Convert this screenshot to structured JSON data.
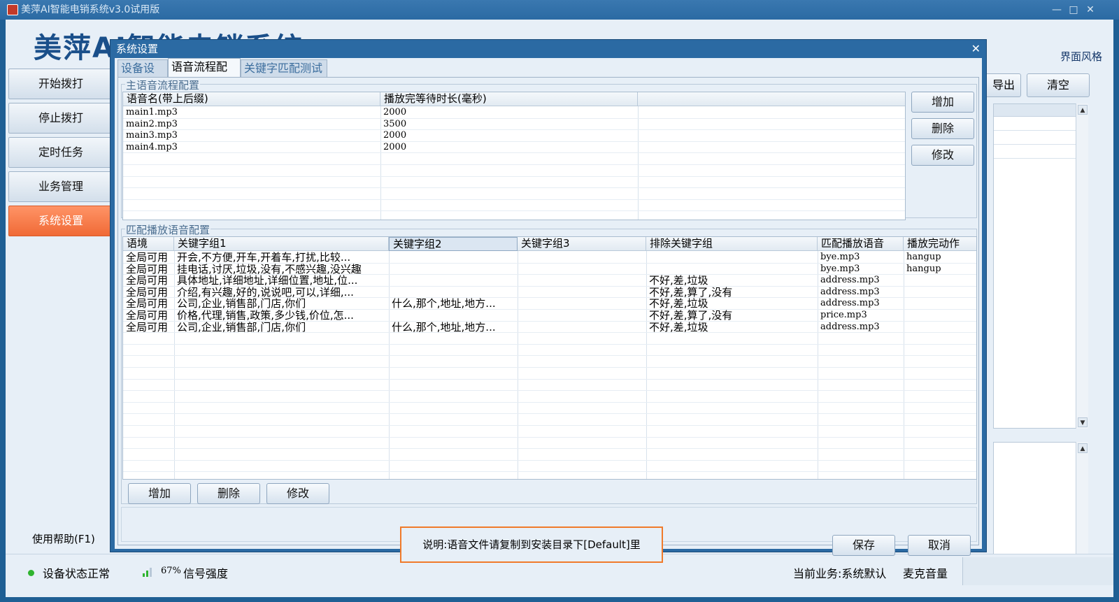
{
  "window": {
    "title": "美萍AI智能电销系统v3.0试用版",
    "brand": "美萍AI智能电销系统",
    "skin_label": "界面风格",
    "min_glyph": "—",
    "max_glyph": "□",
    "close_glyph": "✕"
  },
  "sidebar": {
    "items": [
      {
        "label": "开始拨打"
      },
      {
        "label": "停止拨打"
      },
      {
        "label": "定时任务"
      },
      {
        "label": "业务管理"
      },
      {
        "label": "系统设置"
      }
    ],
    "help": "使用帮助(F1)"
  },
  "background": {
    "export_label": "导出",
    "clear_label": "清空"
  },
  "statusbar": {
    "device_status": "设备状态正常",
    "signal_percent": "67%",
    "signal_label": "信号强度",
    "current_business": "当前业务:系统默认",
    "mic_volume": "麦克音量"
  },
  "dialog": {
    "title": "系统设置",
    "close_glyph": "✕",
    "tabs": [
      "设备设置",
      "语音流程配置",
      "关键字匹配测试"
    ],
    "main_group_title": "主语音流程配置",
    "main_columns": [
      "语音名(带上后缀)",
      "播放完等待时长(毫秒)",
      ""
    ],
    "main_rows": [
      [
        "main1.mp3",
        "2000"
      ],
      [
        "main2.mp3",
        "3500"
      ],
      [
        "main3.mp3",
        "2000"
      ],
      [
        "main4.mp3",
        "2000"
      ]
    ],
    "main_buttons": {
      "add": "增加",
      "delete": "删除",
      "edit": "修改"
    },
    "match_group_title": "匹配播放语音配置",
    "match_columns": [
      "语境",
      "关键字组1",
      "关键字组2",
      "关键字组3",
      "排除关键字组",
      "匹配播放语音",
      "播放完动作"
    ],
    "match_rows": [
      [
        "全局可用",
        "开会,不方便,开车,开着车,打扰,比较...",
        "",
        "",
        "",
        "bye.mp3",
        "hangup"
      ],
      [
        "全局可用",
        "挂电话,讨厌,垃圾,没有,不感兴趣,没兴趣",
        "",
        "",
        "",
        "bye.mp3",
        "hangup"
      ],
      [
        "全局可用",
        "具体地址,详细地址,详细位置,地址,位...",
        "",
        "",
        "不好,差,垃圾",
        "address.mp3",
        ""
      ],
      [
        "全局可用",
        "介绍,有兴趣,好的,说说吧,可以,详细,...",
        "",
        "",
        "不好,差,算了,没有",
        "address.mp3",
        ""
      ],
      [
        "全局可用",
        "公司,企业,销售部,门店,你们",
        "什么,那个,地址,地方...",
        "",
        "不好,差,垃圾",
        "address.mp3",
        ""
      ],
      [
        "全局可用",
        "价格,代理,销售,政策,多少钱,价位,怎...",
        "",
        "",
        "不好,差,算了,没有",
        "price.mp3",
        ""
      ],
      [
        "全局可用",
        "公司,企业,销售部,门店,你们",
        "什么,那个,地址,地方...",
        "",
        "不好,差,垃圾",
        "address.mp3",
        ""
      ]
    ],
    "match_buttons": {
      "add": "增加",
      "delete": "删除",
      "edit": "修改"
    },
    "note": "说明:语音文件请复制到安装目录下[Default]里",
    "save_label": "保存",
    "cancel_label": "取消"
  }
}
